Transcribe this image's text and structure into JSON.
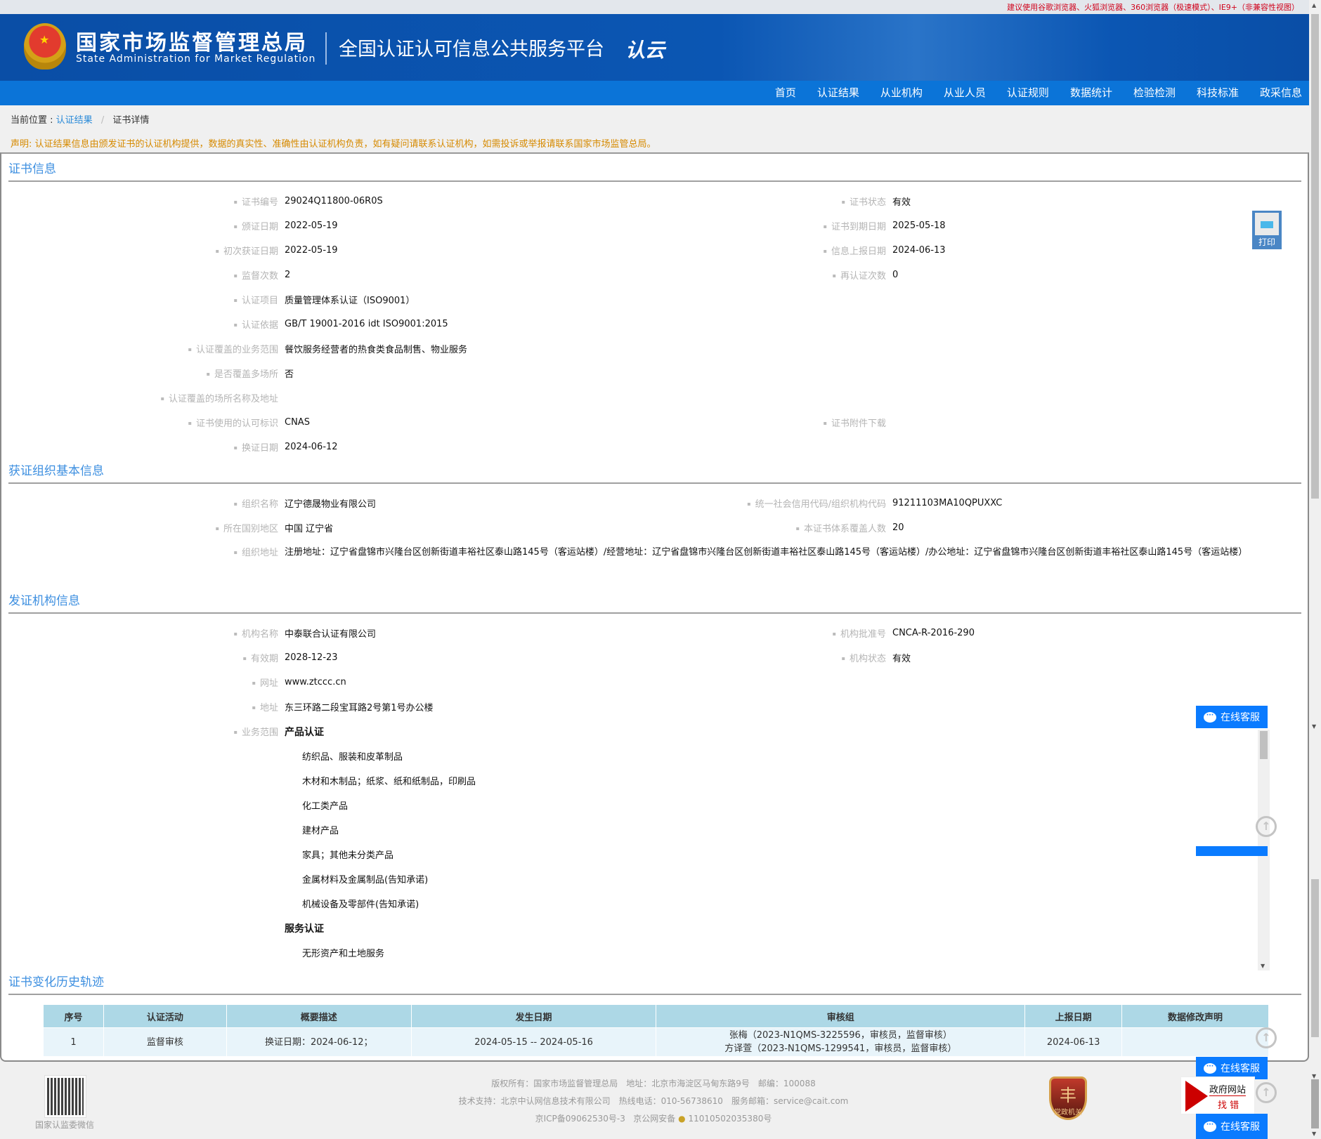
{
  "topbar": {
    "browser_tip": "建议使用谷歌浏览器、火狐浏览器、360浏览器（极速模式）、IE9+（非兼容性视图）"
  },
  "header": {
    "agency_cn": "国家市场监督管理总局",
    "agency_en": "State Administration  for  Market Regulation",
    "platform": "全国认证认可信息公共服务平台",
    "logo_text": "认云"
  },
  "nav": [
    "首页",
    "认证结果",
    "从业机构",
    "从业人员",
    "认证规则",
    "数据统计",
    "检验检测",
    "科技标准",
    "政采信息"
  ],
  "breadcrumb": {
    "prefix": "当前位置 :",
    "items": [
      "认证结果",
      "证书详情"
    ]
  },
  "notice": "声明: 认证结果信息由颁发证书的认证机构提供，数据的真实性、准确性由认证机构负责，如有疑问请联系认证机构，如需投诉或举报请联系国家市场监管总局。",
  "cert": {
    "title": "证书信息",
    "rows": [
      {
        "l1": "证书编号",
        "v1": "29024Q11800-06R0S",
        "l2": "证书状态",
        "v2": "有效"
      },
      {
        "l1": "颁证日期",
        "v1": "2022-05-19",
        "l2": "证书到期日期",
        "v2": "2025-05-18"
      },
      {
        "l1": "初次获证日期",
        "v1": "2022-05-19",
        "l2": "信息上报日期",
        "v2": "2024-06-13"
      },
      {
        "l1": "监督次数",
        "v1": "2",
        "l2": "再认证次数",
        "v2": "0"
      },
      {
        "l1": "认证项目",
        "v1": "质量管理体系认证（ISO9001）"
      },
      {
        "l1": "认证依据",
        "v1": "GB/T 19001-2016 idt ISO9001:2015"
      },
      {
        "l1": "认证覆盖的业务范围",
        "v1": "餐饮服务经营者的热食类食品制售、物业服务"
      },
      {
        "l1": "是否覆盖多场所",
        "v1": "否"
      },
      {
        "l1": "认证覆盖的场所名称及地址",
        "v1": ""
      },
      {
        "l1": "证书使用的认可标识",
        "v1": "CNAS",
        "l2": "证书附件下载",
        "v2": ""
      },
      {
        "l1": "换证日期",
        "v1": "2024-06-12"
      }
    ],
    "print_label": "打印"
  },
  "org": {
    "title": "获证组织基本信息",
    "rows": [
      {
        "l1": "组织名称",
        "v1": "辽宁德晟物业有限公司",
        "l2": "统一社会信用代码/组织机构代码",
        "v2": "91211103MA10QPUXXC"
      },
      {
        "l1": "所在国别地区",
        "v1": "中国 辽宁省",
        "l2": "本证书体系覆盖人数",
        "v2": "20"
      }
    ],
    "address_label": "组织地址",
    "address": "注册地址：辽宁省盘锦市兴隆台区创新街道丰裕社区泰山路145号（客运站楼）/经营地址：辽宁省盘锦市兴隆台区创新街道丰裕社区泰山路145号（客运站楼）/办公地址：辽宁省盘锦市兴隆台区创新街道丰裕社区泰山路145号（客运站楼）"
  },
  "issuer": {
    "title": "发证机构信息",
    "rows": [
      {
        "l1": "机构名称",
        "v1": "中泰联合认证有限公司",
        "l2": "机构批准号",
        "v2": "CNCA-R-2016-290"
      },
      {
        "l1": "有效期",
        "v1": "2028-12-23",
        "l2": "机构状态",
        "v2": "有效"
      },
      {
        "l1": "网址",
        "v1": "www.ztccc.cn"
      },
      {
        "l1": "地址",
        "v1": "东三环路二段宝耳路2号第1号办公楼"
      }
    ],
    "scope_label": "业务范围",
    "scope": [
      {
        "heading": "产品认证",
        "items": [
          "纺织品、服装和皮革制品",
          "木材和木制品；纸浆、纸和纸制品，印刷品",
          "化工类产品",
          "建材产品",
          "家具；其他未分类产品",
          "金属材料及金属制品(告知承诺)",
          "机械设备及零部件(告知承诺)"
        ]
      },
      {
        "heading": "服务认证",
        "items": [
          "无形资产和土地服务"
        ]
      }
    ]
  },
  "history": {
    "title": "证书变化历史轨迹",
    "columns": [
      "序号",
      "认证活动",
      "概要描述",
      "发生日期",
      "审核组",
      "上报日期",
      "数据修改声明"
    ],
    "rows": [
      {
        "no": "1",
        "activity": "监督审核",
        "summary": "换证日期：2024-06-12；",
        "date": "2024-05-15 -- 2024-05-16",
        "team": [
          "张梅（2023-N1QMS-3225596，审核员，监督审核）",
          "方译萱（2023-N1QMS-1299541，审核员，监督审核）"
        ],
        "report_date": "2024-06-13",
        "statement": ""
      }
    ]
  },
  "widgets": {
    "online_service": "在线客服",
    "gov_site_1": "政府网站",
    "gov_site_2": "找 错"
  },
  "footer": {
    "qr_caption": "国家认监委微信",
    "line1": "版权所有：国家市场监督管理总局　地址：北京市海淀区马甸东路9号　邮编：100088",
    "line2": "技术支持：北京中认网信息技术有限公司　热线电话：010-56738610　服务邮箱：service@cait.com",
    "icp": "京ICP备09062530号-3",
    "police_prefix": "京公网安备",
    "police_no": "11010502035380号",
    "badge": "党政机关"
  }
}
